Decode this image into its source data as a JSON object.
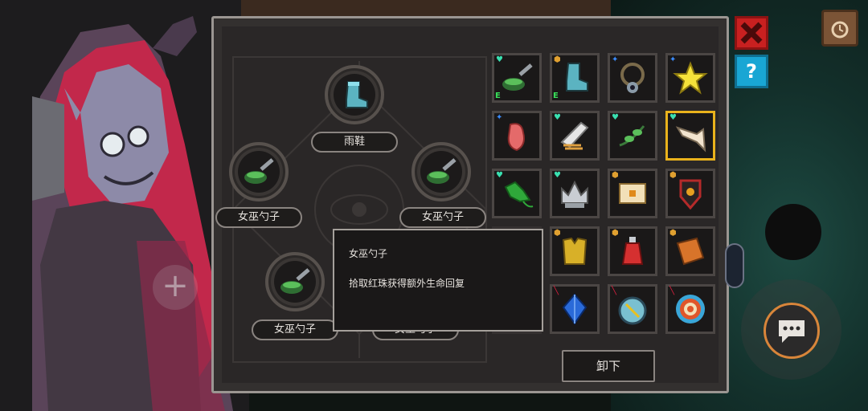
{
  "equipped": {
    "top": {
      "label": "雨鞋",
      "icon": "rain-boot-icon"
    },
    "left": {
      "label": "女巫勺子",
      "icon": "witch-spoon-icon"
    },
    "right": {
      "label": "女巫勺子",
      "icon": "witch-spoon-icon"
    },
    "bottom_left": {
      "label": "女巫勺子",
      "icon": "witch-spoon-icon"
    },
    "bottom_right": {
      "label": "女巫勺子",
      "icon": "witch-spoon-icon"
    }
  },
  "inventory": [
    {
      "icon": "witch-spoon-icon",
      "badge": "heart",
      "equipped_mark": "E"
    },
    {
      "icon": "rain-boot-icon",
      "badge": "shield",
      "equipped_mark": "E"
    },
    {
      "icon": "amulet-icon",
      "badge": "star",
      "equipped_mark": ""
    },
    {
      "icon": "star-icon",
      "badge": "star",
      "equipped_mark": ""
    },
    {
      "icon": "meat-icon",
      "badge": "star",
      "equipped_mark": ""
    },
    {
      "icon": "wing-icon",
      "badge": "heart",
      "equipped_mark": ""
    },
    {
      "icon": "vine-icon",
      "badge": "heart",
      "equipped_mark": ""
    },
    {
      "icon": "bone-icon",
      "badge": "heart",
      "equipped_mark": ""
    },
    {
      "icon": "clover-icon",
      "badge": "heart",
      "equipped_mark": ""
    },
    {
      "icon": "crown-icon",
      "badge": "heart",
      "equipped_mark": ""
    },
    {
      "icon": "chest-icon",
      "badge": "shield",
      "equipped_mark": ""
    },
    {
      "icon": "shield-emblem-icon",
      "badge": "shield",
      "equipped_mark": ""
    },
    {
      "icon": "cloak-icon",
      "badge": "shield",
      "equipped_mark": ""
    },
    {
      "icon": "armor-icon",
      "badge": "shield",
      "equipped_mark": ""
    },
    {
      "icon": "potion-icon",
      "badge": "shield",
      "equipped_mark": ""
    },
    {
      "icon": "scroll-icon",
      "badge": "shield",
      "equipped_mark": ""
    },
    {
      "icon": "snake-icon",
      "badge": "shield",
      "equipped_mark": ""
    },
    {
      "icon": "gem-icon",
      "badge": "sword",
      "equipped_mark": ""
    },
    {
      "icon": "compass-icon",
      "badge": "sword",
      "equipped_mark": ""
    },
    {
      "icon": "target-icon",
      "badge": "sword",
      "equipped_mark": ""
    }
  ],
  "tooltip": {
    "title": "女巫勺子",
    "description": "拾取红珠获得额外生命回复"
  },
  "buttons": {
    "unequip": "卸下",
    "help": "?"
  },
  "colors": {
    "accent_selected": "#e9b21c",
    "heart_badge": "#39e0b0",
    "star_badge": "#3a8cff",
    "shield_badge": "#e0a030",
    "sword_badge": "#e02040",
    "equip_mark": "#39e05a",
    "close_button": "#c82020",
    "help_button": "#19a6d4"
  }
}
